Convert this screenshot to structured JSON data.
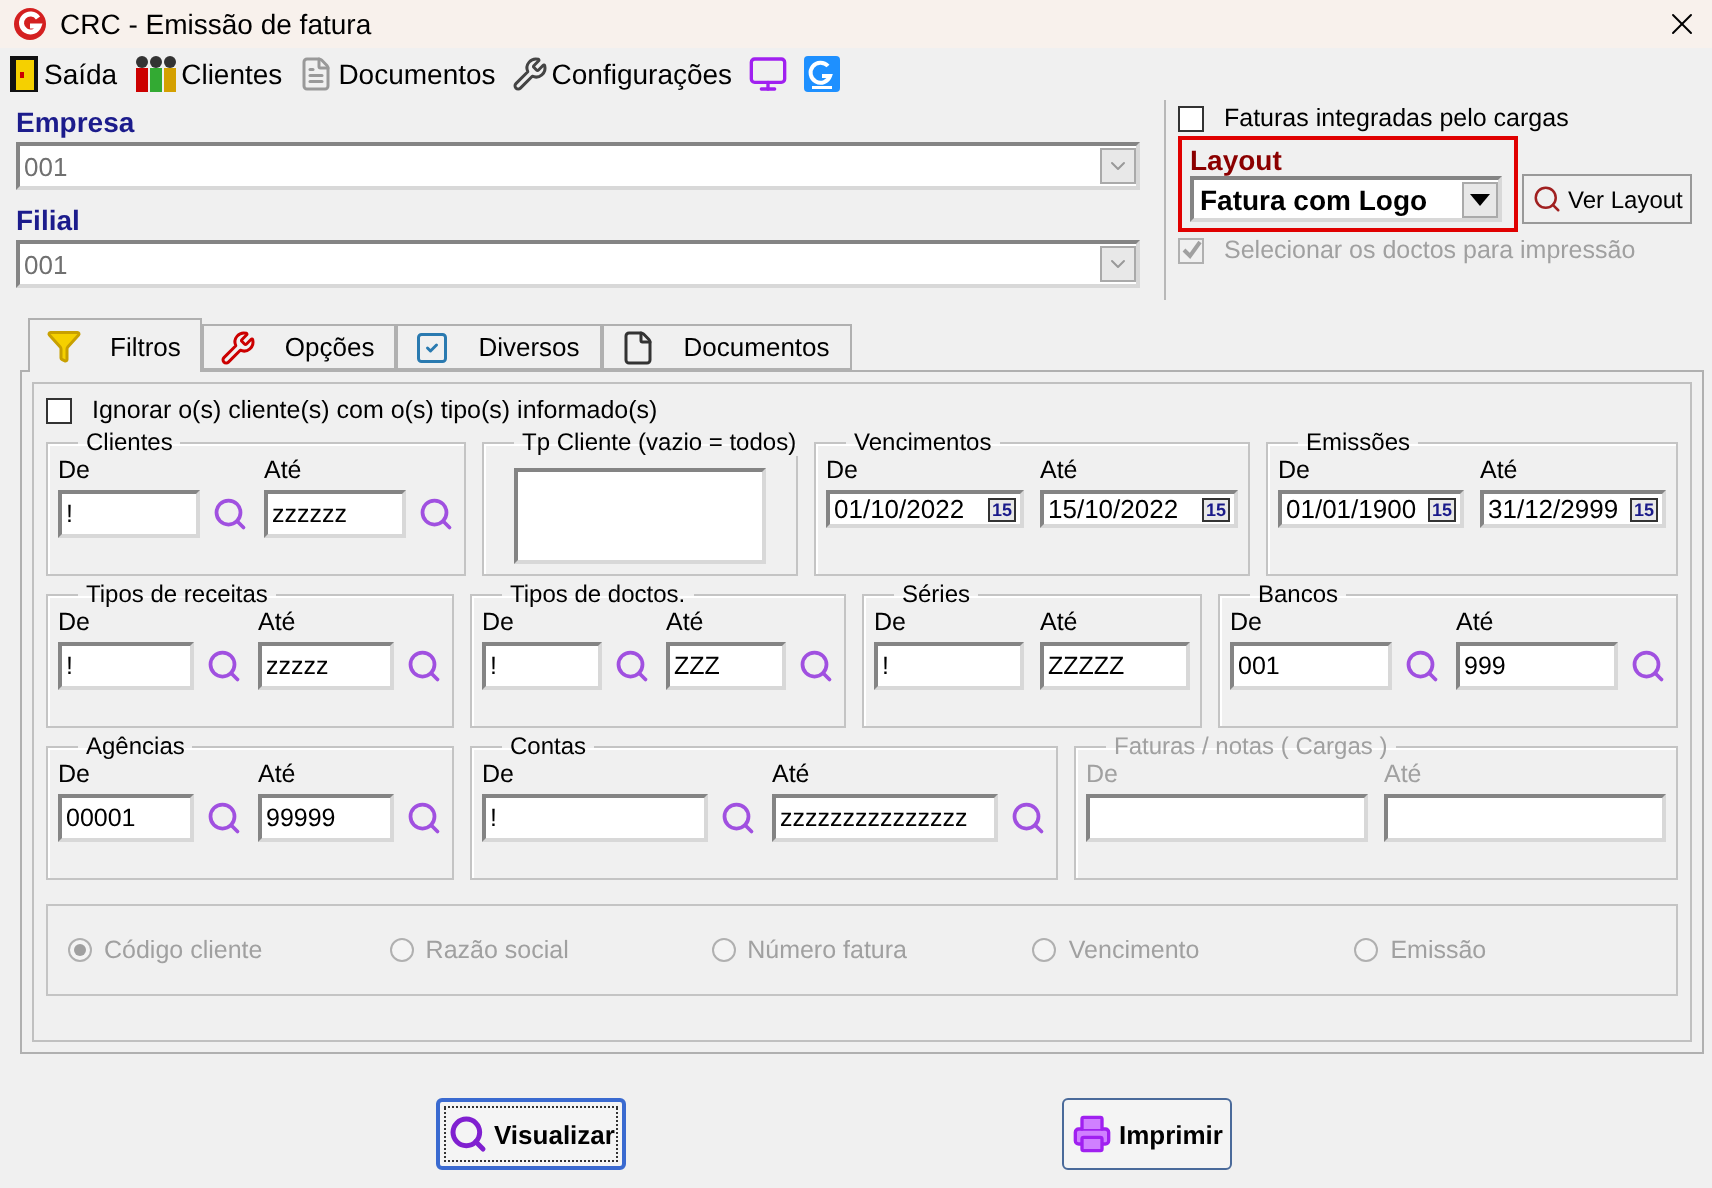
{
  "window": {
    "title": "CRC - Emissão de fatura"
  },
  "toolbar": [
    {
      "kind": "exit",
      "label": "Saída"
    },
    {
      "kind": "clients",
      "label": "Clientes"
    },
    {
      "kind": "documents",
      "label": "Documentos"
    },
    {
      "kind": "settings",
      "label": "Configurações"
    },
    {
      "kind": "monitor"
    },
    {
      "kind": "app"
    }
  ],
  "empresa": {
    "label": "Empresa",
    "value": "001"
  },
  "filial": {
    "label": "Filial",
    "value": "001"
  },
  "faturas_integradas": {
    "label": "Faturas integradas pelo cargas",
    "checked": false,
    "disabled": false
  },
  "layout": {
    "label": "Layout",
    "value": "Fatura com Logo",
    "highlighted": true
  },
  "ver_layout_button": "Ver Layout",
  "selecionar_doctos": {
    "label": "Selecionar os doctos para impressão",
    "checked": true,
    "disabled": true
  },
  "tabs": [
    {
      "kind": "filter",
      "label": "Filtros",
      "selected": true
    },
    {
      "kind": "options",
      "label": "Opções",
      "selected": false
    },
    {
      "kind": "check",
      "label": "Diversos",
      "selected": false
    },
    {
      "kind": "document",
      "label": "Documentos",
      "selected": false
    }
  ],
  "filters": {
    "ignorar": {
      "label": "Ignorar o(s) cliente(s) com o(s) tipo(s) informado(s)",
      "checked": false,
      "disabled": false
    },
    "rows": [
      [
        {
          "kind": "range",
          "title": "Clientes",
          "disabled": false,
          "fields": [
            {
              "label": "De",
              "value": "!",
              "lookup": true
            },
            {
              "label": "Até",
              "value": "zzzzzz",
              "lookup": true
            }
          ]
        },
        {
          "kind": "list",
          "title": "Tp Cliente (vazio = todos)",
          "disabled": false
        },
        {
          "kind": "date",
          "title": "Vencimentos",
          "disabled": false,
          "fields": [
            {
              "label": "De",
              "value": "01/10/2022",
              "picker": "15"
            },
            {
              "label": "Até",
              "value": "15/10/2022",
              "picker": "15"
            }
          ]
        },
        {
          "kind": "date",
          "title": "Emissões",
          "disabled": false,
          "fields": [
            {
              "label": "De",
              "value": "01/01/1900",
              "picker": "15"
            },
            {
              "label": "Até",
              "value": "31/12/2999",
              "picker": "15"
            }
          ]
        }
      ],
      [
        {
          "kind": "range",
          "title": "Tipos de receitas",
          "disabled": false,
          "fields": [
            {
              "label": "De",
              "value": "!",
              "lookup": true
            },
            {
              "label": "Até",
              "value": "zzzzz",
              "lookup": true
            }
          ]
        },
        {
          "kind": "range",
          "title": "Tipos de doctos.",
          "disabled": false,
          "fields": [
            {
              "label": "De",
              "value": "!",
              "lookup": true
            },
            {
              "label": "Até",
              "value": "ZZZ",
              "lookup": true
            }
          ]
        },
        {
          "kind": "range",
          "title": "Séries",
          "disabled": false,
          "fields": [
            {
              "label": "De",
              "value": "!",
              "lookup": false
            },
            {
              "label": "Até",
              "value": "ZZZZZ",
              "lookup": false
            }
          ]
        },
        {
          "kind": "range",
          "title": "Bancos",
          "disabled": false,
          "fields": [
            {
              "label": "De",
              "value": "001",
              "lookup": true
            },
            {
              "label": "Até",
              "value": "999",
              "lookup": true
            }
          ]
        }
      ],
      [
        {
          "kind": "range",
          "title": "Agências",
          "disabled": false,
          "fields": [
            {
              "label": "De",
              "value": "00001",
              "lookup": true
            },
            {
              "label": "Até",
              "value": "99999",
              "lookup": true
            }
          ]
        },
        {
          "kind": "range",
          "title": "Contas",
          "disabled": false,
          "fields": [
            {
              "label": "De",
              "value": "!",
              "lookup": true
            },
            {
              "label": "Até",
              "value": "zzzzzzzzzzzzzzz",
              "lookup": true
            }
          ]
        },
        {
          "kind": "range",
          "title": "Faturas / notas ( Cargas )",
          "disabled": true,
          "fields": [
            {
              "label": "De",
              "lookup": false
            },
            {
              "label": "Até",
              "lookup": false
            }
          ]
        }
      ]
    ],
    "sort": {
      "disabled": true,
      "options": [
        {
          "label": "Código cliente",
          "selected": true
        },
        {
          "label": "Razão social",
          "selected": false
        },
        {
          "label": "Número fatura",
          "selected": false
        },
        {
          "label": "Vencimento",
          "selected": false
        },
        {
          "label": "Emissão",
          "selected": false
        }
      ]
    }
  },
  "buttons": [
    {
      "kind": "preview",
      "label": "Visualizar",
      "default": true
    },
    {
      "kind": "print",
      "label": "Imprimir",
      "default": false
    }
  ]
}
